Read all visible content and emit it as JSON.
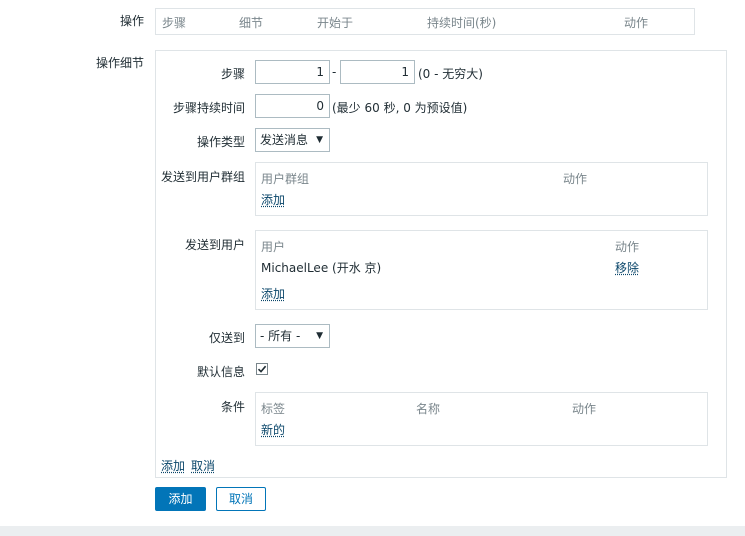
{
  "operations": {
    "label": "操作",
    "columns": [
      "步骤",
      "细节",
      "开始于",
      "持续时间(秒)",
      "动作"
    ]
  },
  "details": {
    "label": "操作细节",
    "step": {
      "label": "步骤",
      "from": "1",
      "separator": "-",
      "to": "1",
      "hint": "(0 - 无穷大)"
    },
    "duration": {
      "label": "步骤持续时间",
      "value": "0",
      "hint": "(最少 60 秒, 0 为预设值)"
    },
    "op_type": {
      "label": "操作类型",
      "selected": "发送消息"
    },
    "send_to_groups": {
      "label": "发送到用户群组",
      "columns": [
        "用户群组",
        "动作"
      ],
      "add_link": "添加"
    },
    "send_to_users": {
      "label": "发送到用户",
      "columns": [
        "用户",
        "动作"
      ],
      "rows": [
        {
          "user": "MichaelLee (开水 京)",
          "action": "移除"
        }
      ],
      "add_link": "添加"
    },
    "send_only_to": {
      "label": "仅送到",
      "selected": "- 所有 -"
    },
    "default_message": {
      "label": "默认信息",
      "checked": true
    },
    "conditions": {
      "label": "条件",
      "columns": [
        "标签",
        "名称",
        "动作"
      ],
      "new_link": "新的"
    },
    "add_link": "添加",
    "cancel_link": "取消"
  },
  "form_buttons": {
    "add": "添加",
    "cancel": "取消"
  }
}
